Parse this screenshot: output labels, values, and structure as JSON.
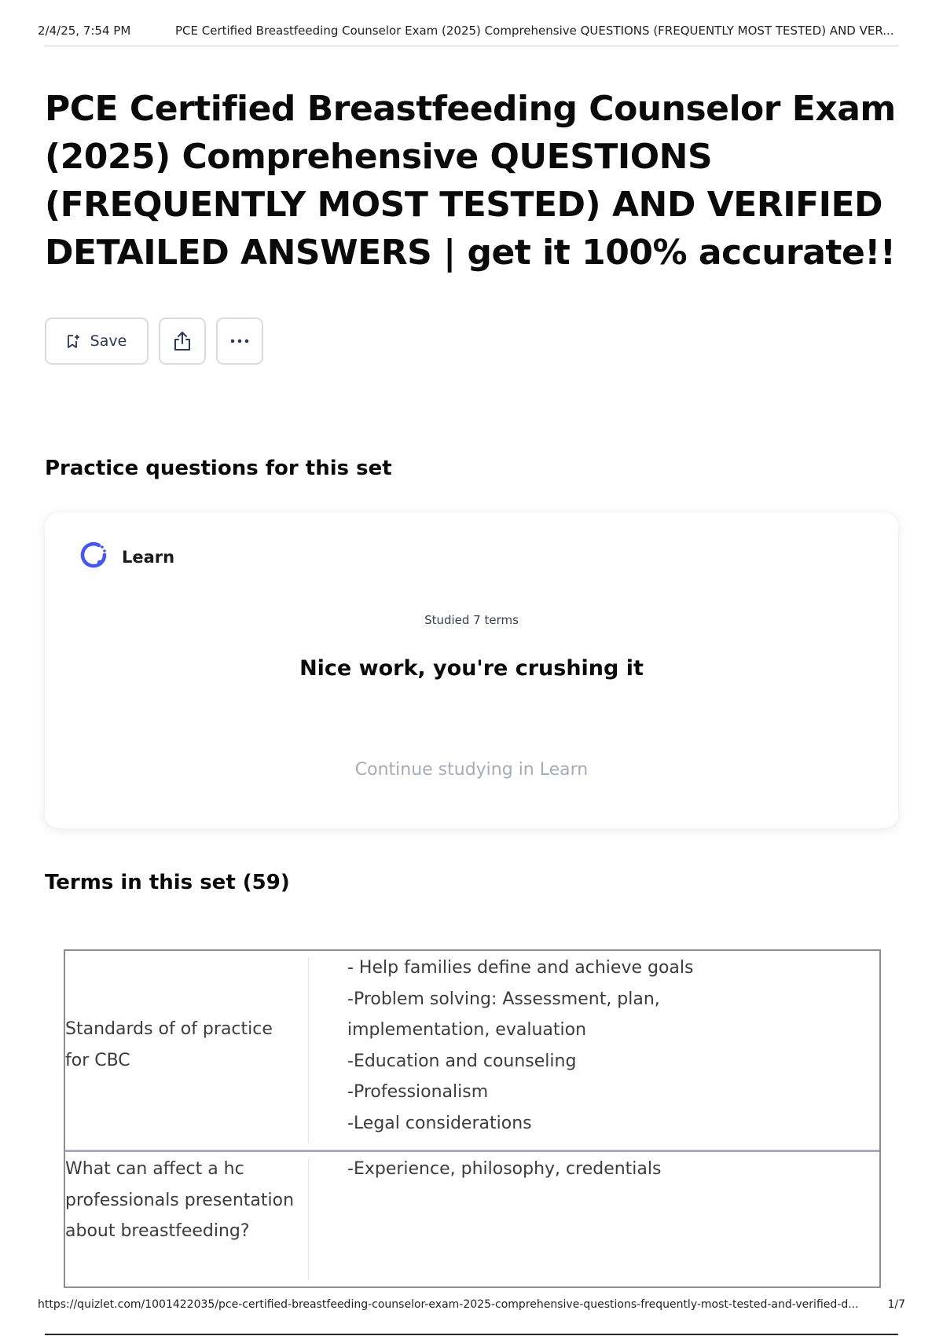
{
  "print_header": {
    "datetime": "2/4/25, 7:54 PM",
    "title": "PCE Certified Breastfeeding Counselor Exam (2025) Comprehensive QUESTIONS (FREQUENTLY MOST TESTED) AND VER..."
  },
  "page": {
    "title": "PCE Certified Breastfeeding Counselor Exam (2025) Comprehensive QUESTIONS (FREQUENTLY MOST TESTED) AND VERIFIED DETAILED ANSWERS | get it 100% accurate!!"
  },
  "toolbar": {
    "save_label": "Save",
    "save_icon": "bookmark-icon",
    "share_icon": "share-icon",
    "more_icon": "more-options-icon"
  },
  "practice": {
    "heading": "Practice questions for this set",
    "mode_label": "Learn",
    "mode_icon": "learn-progress-icon",
    "studied_text": "Studied 7 terms",
    "praise_text": "Nice work, you're crushing it",
    "continue_label": "Continue studying in Learn",
    "accent_color": "#4255ff"
  },
  "terms": {
    "heading": "Terms in this set (59)",
    "rows": [
      {
        "term": "Standards of of practice for CBC",
        "definition_lines": [
          "- Help families define and achieve goals",
          "-Problem solving: Assessment, plan,",
          "implementation, evaluation",
          "-Education and counseling",
          "-Professionalism",
          "-Legal considerations"
        ]
      },
      {
        "term": "What can affect a hc professionals presentation about breastfeeding?",
        "definition_lines": [
          "-Experience, philosophy, credentials"
        ]
      }
    ]
  },
  "print_footer": {
    "url": "https://quizlet.com/1001422035/pce-certified-breastfeeding-counselor-exam-2025-comprehensive-questions-frequently-most-tested-and-verified-d...",
    "page_number": "1/7"
  }
}
